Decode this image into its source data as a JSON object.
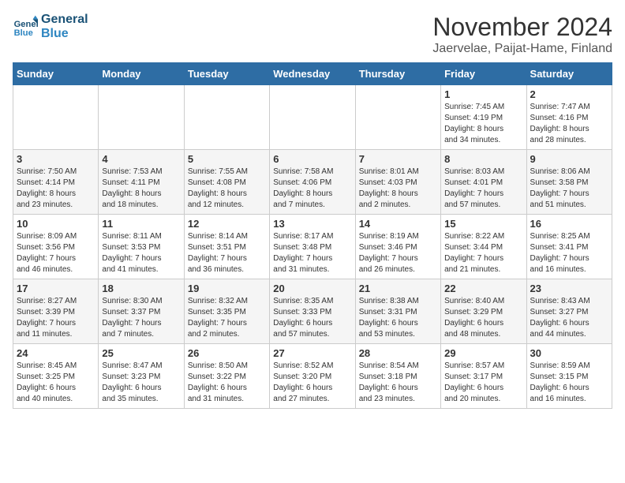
{
  "header": {
    "logo_line1": "General",
    "logo_line2": "Blue",
    "title": "November 2024",
    "subtitle": "Jaervelae, Paijat-Hame, Finland"
  },
  "columns": [
    "Sunday",
    "Monday",
    "Tuesday",
    "Wednesday",
    "Thursday",
    "Friday",
    "Saturday"
  ],
  "weeks": [
    [
      {
        "day": "",
        "info": ""
      },
      {
        "day": "",
        "info": ""
      },
      {
        "day": "",
        "info": ""
      },
      {
        "day": "",
        "info": ""
      },
      {
        "day": "",
        "info": ""
      },
      {
        "day": "1",
        "info": "Sunrise: 7:45 AM\nSunset: 4:19 PM\nDaylight: 8 hours\nand 34 minutes."
      },
      {
        "day": "2",
        "info": "Sunrise: 7:47 AM\nSunset: 4:16 PM\nDaylight: 8 hours\nand 28 minutes."
      }
    ],
    [
      {
        "day": "3",
        "info": "Sunrise: 7:50 AM\nSunset: 4:14 PM\nDaylight: 8 hours\nand 23 minutes."
      },
      {
        "day": "4",
        "info": "Sunrise: 7:53 AM\nSunset: 4:11 PM\nDaylight: 8 hours\nand 18 minutes."
      },
      {
        "day": "5",
        "info": "Sunrise: 7:55 AM\nSunset: 4:08 PM\nDaylight: 8 hours\nand 12 minutes."
      },
      {
        "day": "6",
        "info": "Sunrise: 7:58 AM\nSunset: 4:06 PM\nDaylight: 8 hours\nand 7 minutes."
      },
      {
        "day": "7",
        "info": "Sunrise: 8:01 AM\nSunset: 4:03 PM\nDaylight: 8 hours\nand 2 minutes."
      },
      {
        "day": "8",
        "info": "Sunrise: 8:03 AM\nSunset: 4:01 PM\nDaylight: 7 hours\nand 57 minutes."
      },
      {
        "day": "9",
        "info": "Sunrise: 8:06 AM\nSunset: 3:58 PM\nDaylight: 7 hours\nand 51 minutes."
      }
    ],
    [
      {
        "day": "10",
        "info": "Sunrise: 8:09 AM\nSunset: 3:56 PM\nDaylight: 7 hours\nand 46 minutes."
      },
      {
        "day": "11",
        "info": "Sunrise: 8:11 AM\nSunset: 3:53 PM\nDaylight: 7 hours\nand 41 minutes."
      },
      {
        "day": "12",
        "info": "Sunrise: 8:14 AM\nSunset: 3:51 PM\nDaylight: 7 hours\nand 36 minutes."
      },
      {
        "day": "13",
        "info": "Sunrise: 8:17 AM\nSunset: 3:48 PM\nDaylight: 7 hours\nand 31 minutes."
      },
      {
        "day": "14",
        "info": "Sunrise: 8:19 AM\nSunset: 3:46 PM\nDaylight: 7 hours\nand 26 minutes."
      },
      {
        "day": "15",
        "info": "Sunrise: 8:22 AM\nSunset: 3:44 PM\nDaylight: 7 hours\nand 21 minutes."
      },
      {
        "day": "16",
        "info": "Sunrise: 8:25 AM\nSunset: 3:41 PM\nDaylight: 7 hours\nand 16 minutes."
      }
    ],
    [
      {
        "day": "17",
        "info": "Sunrise: 8:27 AM\nSunset: 3:39 PM\nDaylight: 7 hours\nand 11 minutes."
      },
      {
        "day": "18",
        "info": "Sunrise: 8:30 AM\nSunset: 3:37 PM\nDaylight: 7 hours\nand 7 minutes."
      },
      {
        "day": "19",
        "info": "Sunrise: 8:32 AM\nSunset: 3:35 PM\nDaylight: 7 hours\nand 2 minutes."
      },
      {
        "day": "20",
        "info": "Sunrise: 8:35 AM\nSunset: 3:33 PM\nDaylight: 6 hours\nand 57 minutes."
      },
      {
        "day": "21",
        "info": "Sunrise: 8:38 AM\nSunset: 3:31 PM\nDaylight: 6 hours\nand 53 minutes."
      },
      {
        "day": "22",
        "info": "Sunrise: 8:40 AM\nSunset: 3:29 PM\nDaylight: 6 hours\nand 48 minutes."
      },
      {
        "day": "23",
        "info": "Sunrise: 8:43 AM\nSunset: 3:27 PM\nDaylight: 6 hours\nand 44 minutes."
      }
    ],
    [
      {
        "day": "24",
        "info": "Sunrise: 8:45 AM\nSunset: 3:25 PM\nDaylight: 6 hours\nand 40 minutes."
      },
      {
        "day": "25",
        "info": "Sunrise: 8:47 AM\nSunset: 3:23 PM\nDaylight: 6 hours\nand 35 minutes."
      },
      {
        "day": "26",
        "info": "Sunrise: 8:50 AM\nSunset: 3:22 PM\nDaylight: 6 hours\nand 31 minutes."
      },
      {
        "day": "27",
        "info": "Sunrise: 8:52 AM\nSunset: 3:20 PM\nDaylight: 6 hours\nand 27 minutes."
      },
      {
        "day": "28",
        "info": "Sunrise: 8:54 AM\nSunset: 3:18 PM\nDaylight: 6 hours\nand 23 minutes."
      },
      {
        "day": "29",
        "info": "Sunrise: 8:57 AM\nSunset: 3:17 PM\nDaylight: 6 hours\nand 20 minutes."
      },
      {
        "day": "30",
        "info": "Sunrise: 8:59 AM\nSunset: 3:15 PM\nDaylight: 6 hours\nand 16 minutes."
      }
    ]
  ]
}
